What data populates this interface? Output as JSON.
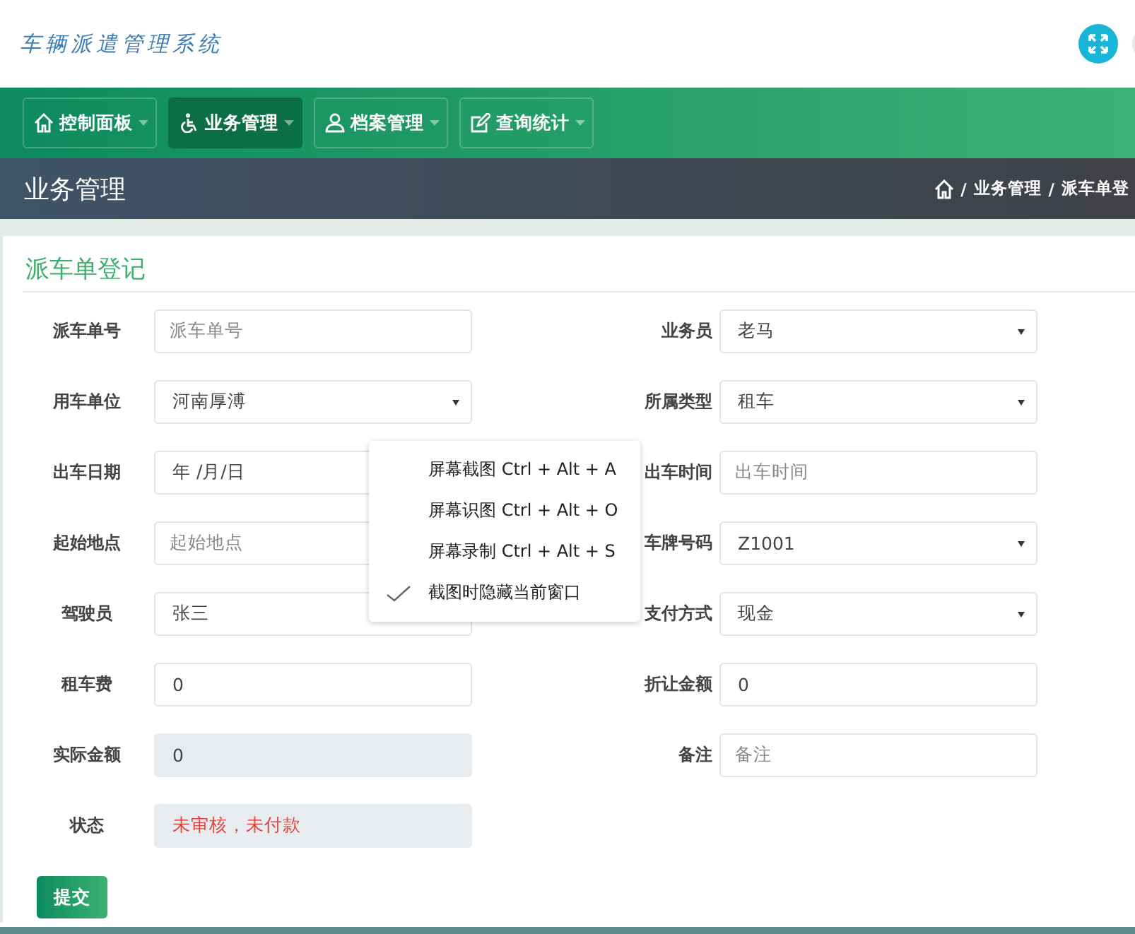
{
  "logo": "车辆派遣管理系统",
  "nav": [
    {
      "label": "控制面板",
      "selected": false
    },
    {
      "label": "业务管理",
      "selected": true
    },
    {
      "label": "档案管理",
      "selected": false
    },
    {
      "label": "查询统计",
      "selected": false
    }
  ],
  "page_title": "业务管理",
  "breadcrumb": [
    "/",
    "业务管理",
    "/",
    "派车单登"
  ],
  "card_title": "派车单登记",
  "fields": [
    {
      "label": "派车单号",
      "kind": "input",
      "placeholder": "派车单号"
    },
    {
      "label": "业务员",
      "kind": "select",
      "value": "老马"
    },
    {
      "label": "用车单位",
      "kind": "select",
      "value": "河南厚溥"
    },
    {
      "label": "所属类型",
      "kind": "select",
      "value": "租车"
    },
    {
      "label": "出车日期",
      "kind": "date",
      "value": "年 /月/日"
    },
    {
      "label": "出车时间",
      "kind": "input",
      "placeholder": "出车时间"
    },
    {
      "label": "起始地点",
      "kind": "input",
      "placeholder": "起始地点"
    },
    {
      "label": "车牌号码",
      "kind": "select",
      "value": "Z1001"
    },
    {
      "label": "驾驶员",
      "kind": "select",
      "value": "张三"
    },
    {
      "label": "支付方式",
      "kind": "select",
      "value": "现金"
    },
    {
      "label": "租车费",
      "kind": "input",
      "value": "0"
    },
    {
      "label": "折让金额",
      "kind": "input",
      "value": "0"
    },
    {
      "label": "实际金额",
      "kind": "readonly",
      "value": "0"
    },
    {
      "label": "备注",
      "kind": "input",
      "placeholder": "备注"
    },
    {
      "label": "状态",
      "kind": "status",
      "value": "未审核，未付款"
    }
  ],
  "submit": "提交",
  "context_menu": [
    {
      "label": "屏幕截图 Ctrl + Alt + A",
      "checked": false
    },
    {
      "label": "屏幕识图 Ctrl + Alt + O",
      "checked": false
    },
    {
      "label": "屏幕录制 Ctrl + Alt + S",
      "checked": false
    },
    {
      "label": "截图时隐藏当前窗口",
      "checked": true
    }
  ]
}
